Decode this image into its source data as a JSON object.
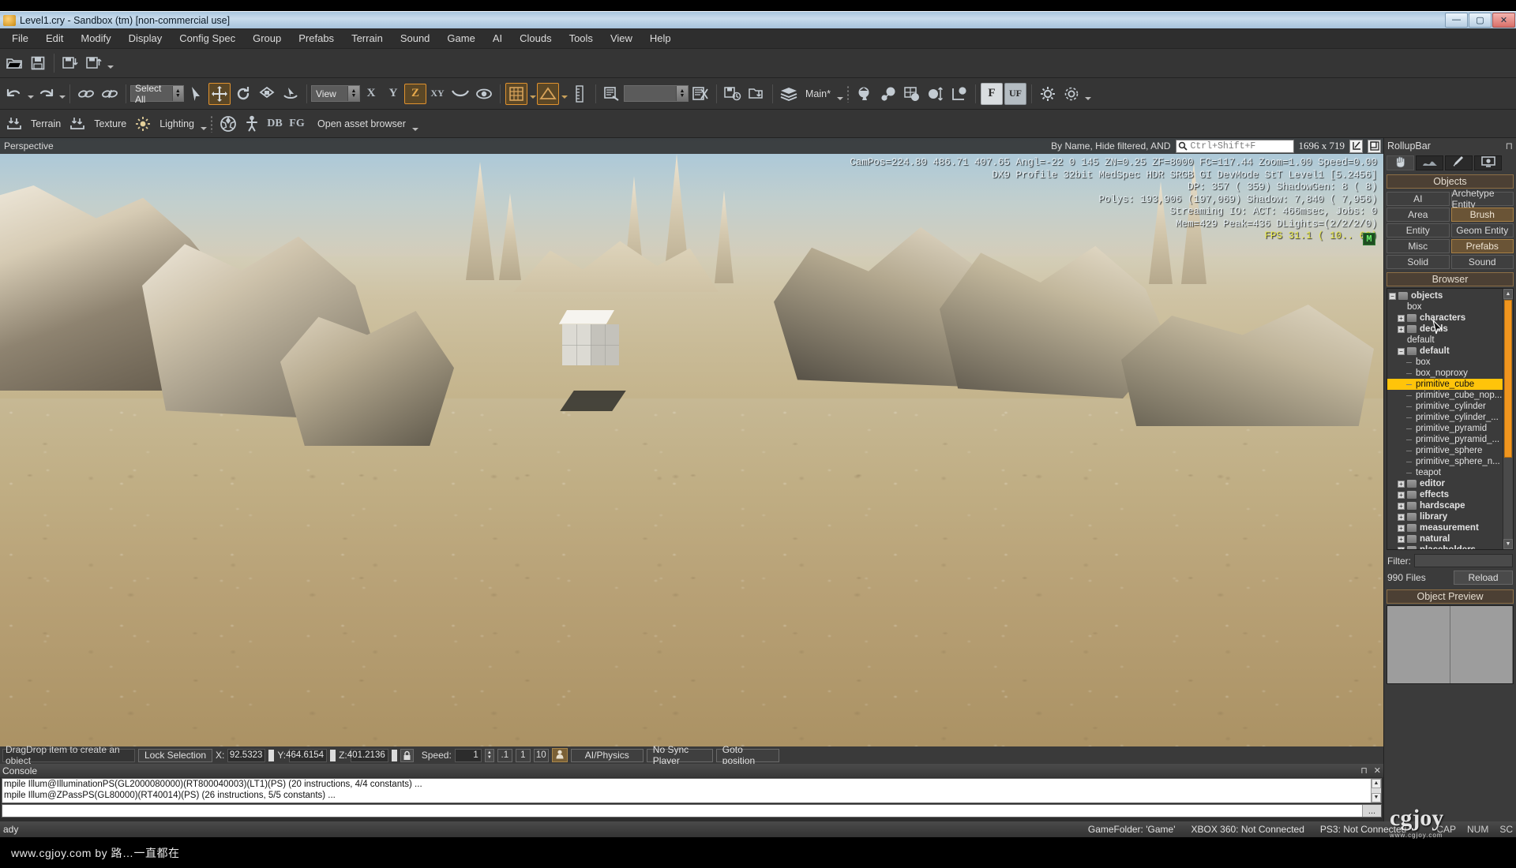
{
  "titlebar": {
    "title": "Level1.cry - Sandbox (tm) [non-commercial use]",
    "minimize": "—",
    "maximize": "▢",
    "close": "✕"
  },
  "menubar": {
    "items": [
      "File",
      "Edit",
      "Modify",
      "Display",
      "Config Spec",
      "Group",
      "Prefabs",
      "Terrain",
      "Sound",
      "Game",
      "AI",
      "Clouds",
      "Tools",
      "View",
      "Help"
    ]
  },
  "toolbar_file": {
    "icons": [
      "open-icon",
      "save-icon",
      "save-level-resources-icon",
      "export-to-engine-icon"
    ]
  },
  "toolbar_edit": {
    "undo": "undo-icon",
    "redo": "redo-icon",
    "link": "link-icon",
    "unlink": "unlink-icon",
    "select_mode": "Select All",
    "tools": [
      "select-object-icon",
      "move-icon",
      "rotate-icon",
      "scale-icon",
      "select-terrain-icon"
    ],
    "coord_system": "View",
    "axis_x": "X",
    "axis_y": "Y",
    "axis_z": "Z",
    "axis_xy": "XY",
    "axis_terrain": "terrain-constrain-icon",
    "axis_object": "object-constrain-icon",
    "snap_grid": "snap-to-grid-icon",
    "snap_angle": "snap-to-angle-icon",
    "ruler": "ruler-icon",
    "goto_selection": "goto-selection-icon",
    "layer_field": "",
    "delete_layer": "remove-icon",
    "save_selection": "save-selection-icon",
    "load_selection": "load-selection-icon",
    "layers_label": "Main*",
    "vegetation_tools": [
      "vegetation-paint-icon",
      "vegetation-flag-icon",
      "vegetation-grid-icon",
      "vegetation-scale-icon",
      "vegetation-align-icon"
    ],
    "freeze": "F",
    "unfreeze": "UF",
    "extra": [
      "gear-icon",
      "gear-alt-icon",
      "layers-icon"
    ]
  },
  "toolbar_terrain": {
    "terrain": "Terrain",
    "texture": "Texture",
    "lighting": "Lighting",
    "material_icon": "material-editor-icon",
    "character_icon": "character-editor-icon",
    "db_label": "DB",
    "fg_label": "FG",
    "asset_browser": "Open asset browser"
  },
  "viewport": {
    "name": "Perspective",
    "filter_mode": "By Name, Hide filtered, AND",
    "search_placeholder": "Ctrl+Shift+F",
    "resolution": "1696 x 719",
    "maximize_icon": "maximize-viewport-icon",
    "layout_icon": "layout-icon",
    "hud": {
      "line1": "CamPos=224.80 486.71 407.65 Angl=-22   0 145 ZN=0.25 ZF=8000 FC=117.44 Zoom=1.00 Speed=0.00",
      "line2": "DX9 Profile 32bit MedSpec HDR SRGB GI DevMode StT Level1 [5.2456]",
      "line3": "DP:   357 ( 359) ShadowGen:  8 (   8)",
      "line4": "Polys: 193,906 (197,069) Shadow: 7,840 ( 7,956)",
      "line5": "Streaming IO: ACT: 466msec, Jobs: 0",
      "line6": "Mem=429 Peak=436 DLights=(2/2/2/0)",
      "fps": "FPS  31.1 ( 10.. 62)",
      "mode_badge": "M"
    }
  },
  "rollupbar": {
    "title": "RollupBar",
    "pin_icon": "pin-icon",
    "tabs": [
      {
        "name": "objects-tab",
        "icon": "hand-icon",
        "active": true
      },
      {
        "name": "terrain-tab",
        "icon": "terrain-icon",
        "active": false
      },
      {
        "name": "modeling-tab",
        "icon": "pencil-icon",
        "active": false
      },
      {
        "name": "display-tab",
        "icon": "monitor-icon",
        "active": false
      }
    ],
    "objects_header": "Objects",
    "object_buttons": [
      {
        "label": "AI",
        "selected": false
      },
      {
        "label": "Archetype Entity",
        "selected": false
      },
      {
        "label": "Area",
        "selected": false
      },
      {
        "label": "Brush",
        "selected": true
      },
      {
        "label": "Entity",
        "selected": false
      },
      {
        "label": "Geom Entity",
        "selected": false
      },
      {
        "label": "Misc",
        "selected": false
      },
      {
        "label": "Prefabs",
        "selected": true
      },
      {
        "label": "Solid",
        "selected": false
      },
      {
        "label": "Sound",
        "selected": false
      }
    ],
    "browser_header": "Browser",
    "tree": [
      {
        "label": "objects",
        "depth": 0,
        "expander": "minus",
        "folder": true,
        "bold": true,
        "selected": false
      },
      {
        "label": "box",
        "depth": 1,
        "expander": "none",
        "folder": false,
        "bold": false,
        "selected": false
      },
      {
        "label": "characters",
        "depth": 1,
        "expander": "plus",
        "folder": true,
        "bold": true,
        "selected": false
      },
      {
        "label": "decals",
        "depth": 1,
        "expander": "plus",
        "folder": true,
        "bold": true,
        "selected": false
      },
      {
        "label": "default",
        "depth": 1,
        "expander": "none",
        "folder": false,
        "bold": false,
        "selected": false
      },
      {
        "label": "default",
        "depth": 1,
        "expander": "minus",
        "folder": true,
        "bold": true,
        "selected": false
      },
      {
        "label": "box",
        "depth": 2,
        "expander": "dash",
        "folder": false,
        "bold": false,
        "selected": false
      },
      {
        "label": "box_noproxy",
        "depth": 2,
        "expander": "dash",
        "folder": false,
        "bold": false,
        "selected": false
      },
      {
        "label": "primitive_cube",
        "depth": 2,
        "expander": "dash",
        "folder": false,
        "bold": false,
        "selected": true
      },
      {
        "label": "primitive_cube_nop...",
        "depth": 2,
        "expander": "dash",
        "folder": false,
        "bold": false,
        "selected": false
      },
      {
        "label": "primitive_cylinder",
        "depth": 2,
        "expander": "dash",
        "folder": false,
        "bold": false,
        "selected": false
      },
      {
        "label": "primitive_cylinder_...",
        "depth": 2,
        "expander": "dash",
        "folder": false,
        "bold": false,
        "selected": false
      },
      {
        "label": "primitive_pyramid",
        "depth": 2,
        "expander": "dash",
        "folder": false,
        "bold": false,
        "selected": false
      },
      {
        "label": "primitive_pyramid_...",
        "depth": 2,
        "expander": "dash",
        "folder": false,
        "bold": false,
        "selected": false
      },
      {
        "label": "primitive_sphere",
        "depth": 2,
        "expander": "dash",
        "folder": false,
        "bold": false,
        "selected": false
      },
      {
        "label": "primitive_sphere_n...",
        "depth": 2,
        "expander": "dash",
        "folder": false,
        "bold": false,
        "selected": false
      },
      {
        "label": "teapot",
        "depth": 2,
        "expander": "dash",
        "folder": false,
        "bold": false,
        "selected": false
      },
      {
        "label": "editor",
        "depth": 1,
        "expander": "plus",
        "folder": true,
        "bold": true,
        "selected": false
      },
      {
        "label": "effects",
        "depth": 1,
        "expander": "plus",
        "folder": true,
        "bold": true,
        "selected": false
      },
      {
        "label": "hardscape",
        "depth": 1,
        "expander": "plus",
        "folder": true,
        "bold": true,
        "selected": false
      },
      {
        "label": "library",
        "depth": 1,
        "expander": "plus",
        "folder": true,
        "bold": true,
        "selected": false
      },
      {
        "label": "measurement",
        "depth": 1,
        "expander": "plus",
        "folder": true,
        "bold": true,
        "selected": false
      },
      {
        "label": "natural",
        "depth": 1,
        "expander": "plus",
        "folder": true,
        "bold": true,
        "selected": false
      },
      {
        "label": "placeholders",
        "depth": 1,
        "expander": "plus",
        "folder": true,
        "bold": true,
        "selected": false
      }
    ],
    "filter_label": "Filter:",
    "filter_value": "",
    "file_count": "990 Files",
    "reload_label": "Reload",
    "preview_header": "Object Preview"
  },
  "statusbar": {
    "drag_hint": "DragDrop item to create an object",
    "lock_selection": "Lock Selection",
    "x_label": "X:",
    "x_value": "92.5323",
    "y_label": "Y:",
    "y_value": "464.6154",
    "z_label": "Z:",
    "z_value": "401.2136",
    "lock_icon": "lock-icon",
    "speed_label": "Speed:",
    "speed_value": "1",
    "speed_presets": [
      ".1",
      "1",
      "10"
    ],
    "person_icon": "person-icon",
    "ai_physics": "AI/Physics",
    "sync_player": "No Sync Player",
    "goto_position": "Goto position"
  },
  "console": {
    "title": "Console",
    "pin": "pin-icon",
    "close": "✕",
    "lines": [
      "mpile Illum@IlluminationPS(GL2000080000)(RT800040003)(LT1)(PS) (20 instructions, 4/4 constants) ...",
      "mpile Illum@ZPassPS(GL80000)(RT40014)(PS) (26 instructions, 5/5 constants) ..."
    ],
    "input_value": "",
    "input_button": "..."
  },
  "bottombar": {
    "ready": "ady",
    "game_folder": "GameFolder: 'Game'",
    "xbox": "XBOX 360: Not Connected",
    "ps3": "PS3: Not Connected",
    "keys": [
      "CAP",
      "NUM",
      "SC"
    ]
  },
  "footer": {
    "text": "www.cgjoy.com by 路…一直都在"
  },
  "watermark": {
    "brand": "cgjoy",
    "url": "www.cgjoy.com"
  },
  "colors": {
    "accent_orange": "#e0922f",
    "selection_yellow": "#ffc40a",
    "panel_bg": "#3b3b3b",
    "toolbar_bg": "#353535",
    "scrollbar_orange": "#f0951e"
  }
}
